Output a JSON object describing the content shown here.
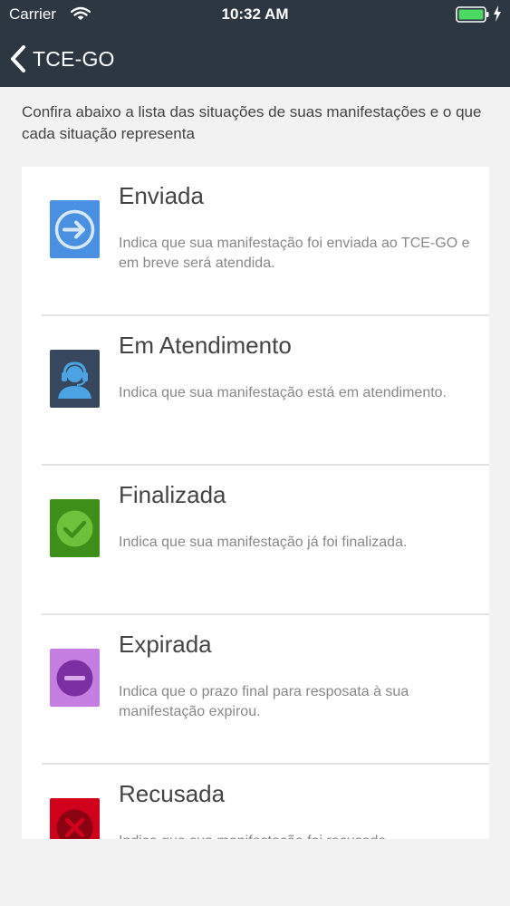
{
  "status_bar": {
    "carrier": "Carrier",
    "time": "10:32 AM",
    "icons": [
      "wifi-icon",
      "battery-icon",
      "charging-bolt-icon"
    ],
    "battery_color": "#4cd964"
  },
  "nav": {
    "back_label": "TCE-GO",
    "back_icon": "chevron-left-icon",
    "bar_color": "#2c3742"
  },
  "intro": "Confira abaixo a lista das situações de suas manifestações e o que cada situação representa",
  "statuses": [
    {
      "title": "Enviada",
      "description": "Indica que sua manifestação foi enviada ao TCE-GO e em breve será atendida.",
      "icon": "arrow-right-circle-icon",
      "color": "#4a90e2"
    },
    {
      "title": "Em Atendimento",
      "description": "Indica que sua manifestação está em atendimento.",
      "icon": "headset-agent-icon",
      "color": "#37485e"
    },
    {
      "title": "Finalizada",
      "description": "Indica que sua manifestação já foi finalizada.",
      "icon": "check-circle-icon",
      "color": "#3e8e1a"
    },
    {
      "title": "Expirada",
      "description": "Indica que o prazo final para resposata à sua manifestação expirou.",
      "icon": "minus-circle-icon",
      "color": "#c47ee0"
    },
    {
      "title": "Recusada",
      "description": "Indica que sua manifestação foi recusada.",
      "icon": "x-circle-icon",
      "color": "#d0021b"
    }
  ]
}
